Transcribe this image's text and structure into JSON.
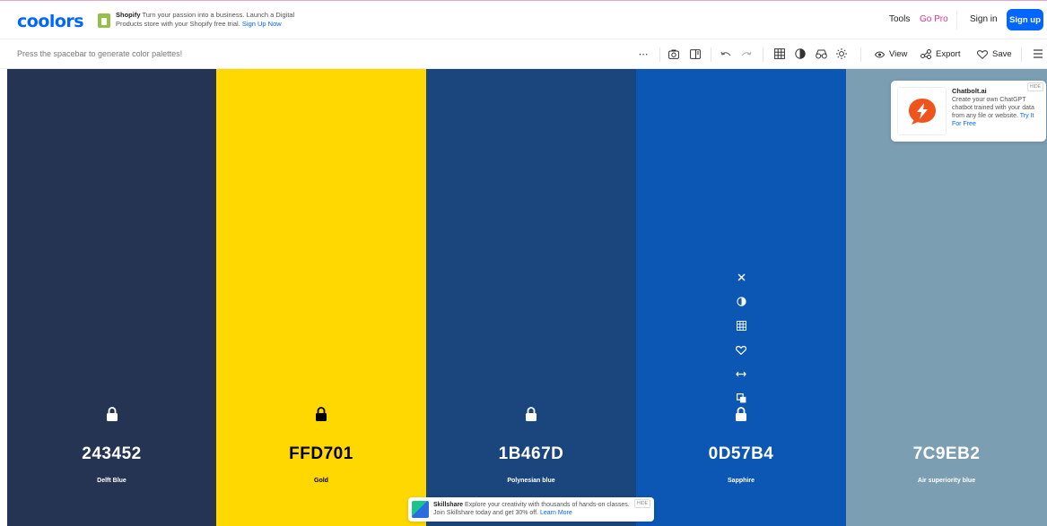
{
  "app": {
    "logo": "coolors"
  },
  "ads": {
    "shopify": {
      "brand": "Shopify",
      "text": "Turn your passion into a business. Launch a Digital Products store with your Shopify free trial.",
      "cta": "Sign Up Now"
    },
    "chatbolt": {
      "title": "Chatbolt.ai",
      "text": "Create your own ChatGPT chatbot trained with your data from any file or website.",
      "cta": "Try It For Free",
      "hide": "HIDE"
    },
    "skillshare": {
      "brand": "Skillshare",
      "text": "Explore your creativity with thousands of hands-on classes. Join Skillshare today and get 30% off.",
      "cta": "Learn More",
      "hide": "HIDE"
    }
  },
  "nav": {
    "tools": "Tools",
    "gopro": "Go Pro",
    "signin": "Sign in",
    "signup": "Sign up"
  },
  "toolbar": {
    "hint": "Press the spacebar to generate color palettes!",
    "more": "⋯",
    "view": "View",
    "export": "Export",
    "save": "Save"
  },
  "palette": [
    {
      "hex": "243452",
      "name": "Delft Blue",
      "bg": "#243452",
      "fg": "#ffffff"
    },
    {
      "hex": "FFD701",
      "name": "Gold",
      "bg": "#FFD701",
      "fg": "#000000"
    },
    {
      "hex": "1B467D",
      "name": "Polynesian blue",
      "bg": "#1B467D",
      "fg": "#ffffff"
    },
    {
      "hex": "0D57B4",
      "name": "Sapphire",
      "bg": "#0D57B4",
      "fg": "#ffffff"
    },
    {
      "hex": "7C9EB2",
      "name": "Air superiority blue",
      "bg": "#7C9EB2",
      "fg": "#ffffff"
    }
  ],
  "column_tools": [
    "close-icon",
    "contrast-icon",
    "shades-icon",
    "heart-icon",
    "drag-icon",
    "copy-icon"
  ],
  "colors": {
    "accent": "#0066ff",
    "pro": "#e8308a"
  }
}
